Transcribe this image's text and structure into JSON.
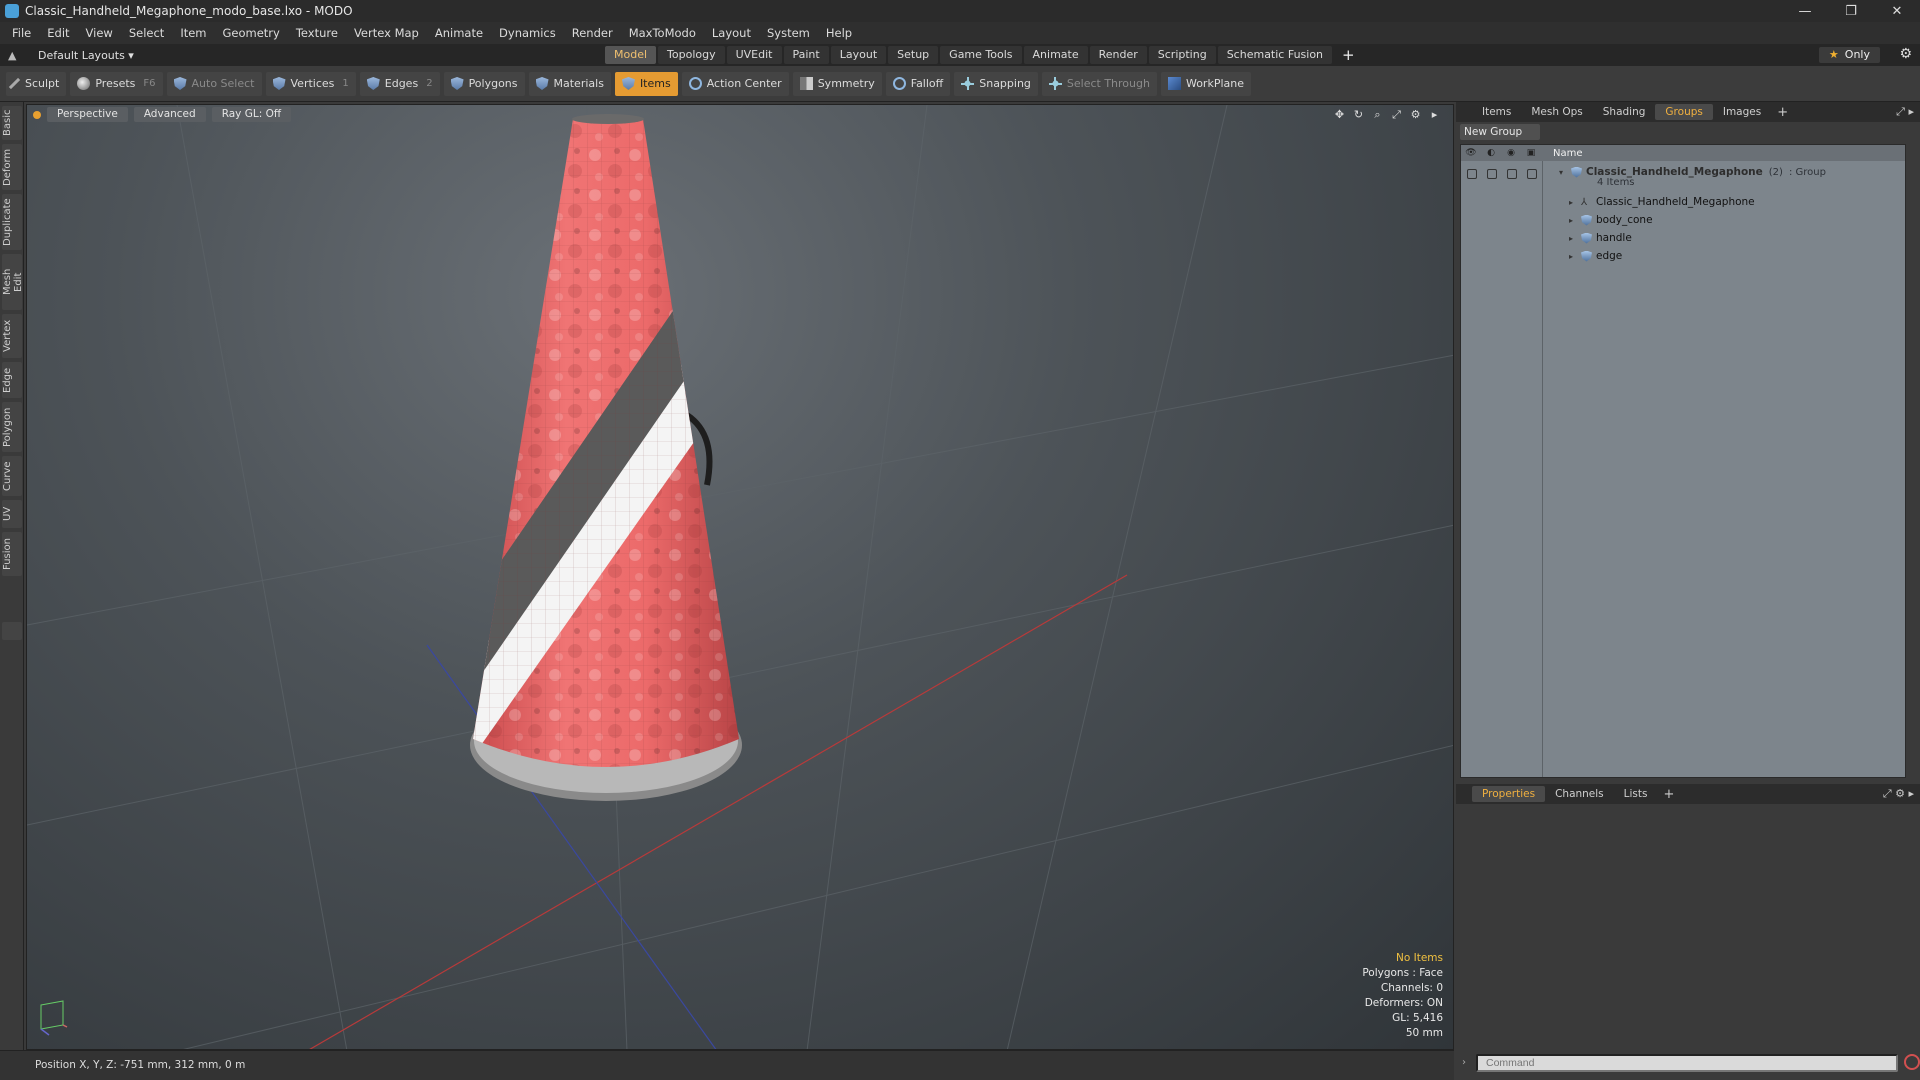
{
  "window": {
    "title": "Classic_Handheld_Megaphone_modo_base.lxo - MODO",
    "controls": [
      "—",
      "❐",
      "✕"
    ]
  },
  "menu": [
    "File",
    "Edit",
    "View",
    "Select",
    "Item",
    "Geometry",
    "Texture",
    "Vertex Map",
    "Animate",
    "Dynamics",
    "Render",
    "MaxToModo",
    "Layout",
    "System",
    "Help"
  ],
  "layoutbar": {
    "layouts_label": "Default Layouts ▾",
    "tabs": [
      "Model",
      "Topology",
      "UVEdit",
      "Paint",
      "Layout",
      "Setup",
      "Game Tools",
      "Animate",
      "Render",
      "Scripting",
      "Schematic Fusion"
    ],
    "active_tab": "Model",
    "plus": "+",
    "only_label": "Only"
  },
  "toolbar": {
    "sculpt": "Sculpt",
    "presets": "Presets",
    "presets_key": "F6",
    "auto_select": "Auto Select",
    "vertices": "Vertices",
    "vertices_count": "1",
    "edges": "Edges",
    "edges_count": "2",
    "polygons": "Polygons",
    "materials": "Materials",
    "items": "Items",
    "action_center": "Action Center",
    "symmetry": "Symmetry",
    "falloff": "Falloff",
    "snapping": "Snapping",
    "select_through": "Select Through",
    "workplane": "WorkPlane"
  },
  "left_tabs": [
    "Basic",
    "Deform",
    "Duplicate",
    "Mesh Edit",
    "Vertex",
    "Edge",
    "Polygon",
    "Curve",
    "UV",
    "Fusion"
  ],
  "viewport": {
    "view": "Perspective",
    "shading": "Advanced",
    "raygl": "Ray GL: Off",
    "info": {
      "no_items": "No Items",
      "polygons": "Polygons : Face",
      "channels": "Channels: 0",
      "deformers": "Deformers: ON",
      "gl": "GL: 5,416",
      "scale": "50 mm"
    }
  },
  "statusbar": {
    "position": "Position X, Y, Z:  -751 mm, 312 mm, 0 m"
  },
  "right_panel": {
    "top_tabs": [
      "Items",
      "Mesh Ops",
      "Shading",
      "Groups",
      "Images"
    ],
    "active_top_tab": "Groups",
    "new_group": "New Group",
    "column_name": "Name",
    "group": {
      "name": "Classic_Handheld_Megaphone",
      "count": "(2)",
      "type": ": Group",
      "items_label": "4 Items"
    },
    "children": [
      "Classic_Handheld_Megaphone",
      "body_cone",
      "handle",
      "edge"
    ],
    "bottom_tabs": [
      "Properties",
      "Channels",
      "Lists"
    ],
    "active_bottom_tab": "Properties",
    "command_placeholder": "Command"
  },
  "colors": {
    "accent": "#e59b32",
    "active_tab_text": "#f0b040",
    "cone_red": "#e8605e"
  }
}
